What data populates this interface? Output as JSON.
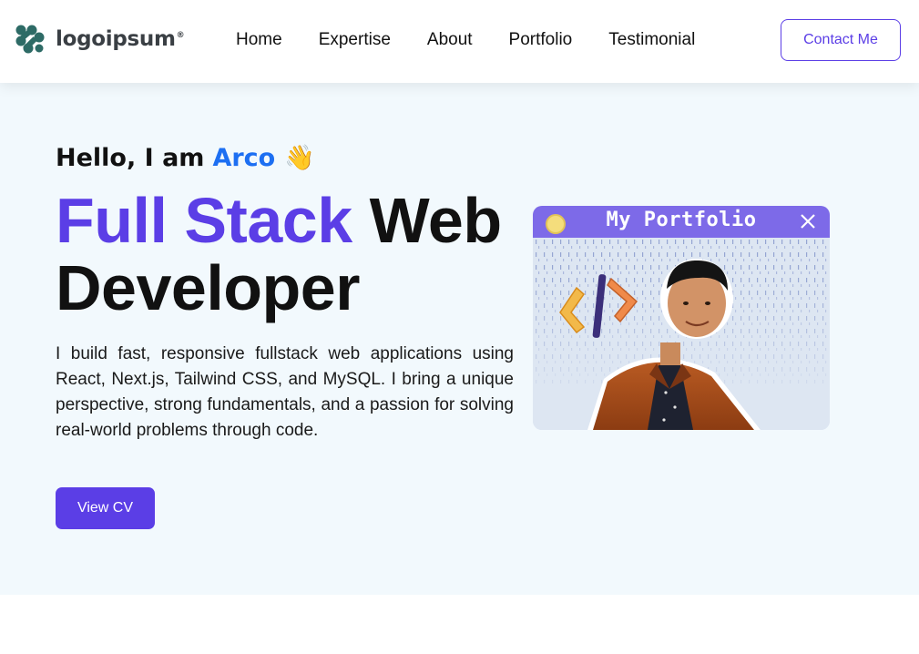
{
  "nav": {
    "logo_text": "logoipsum",
    "logo_mark": "®",
    "links": [
      "Home",
      "Expertise",
      "About",
      "Portfolio",
      "Testimonial"
    ],
    "contact_label": "Contact Me"
  },
  "hero": {
    "greeting": "Hello, I am",
    "name": "Arco",
    "wave": "👋",
    "headline_accent": "Full Stack",
    "headline_rest": " Web Developer",
    "description": "I build fast, responsive fullstack web applications using React, Next.js, Tailwind CSS, and MySQL. I bring a unique perspective, strong fundamentals, and a passion for solving real-world problems through code.",
    "cv_label": "View CV"
  },
  "portfolio_card": {
    "title": "My Portfolio",
    "code_symbol": "</>"
  },
  "colors": {
    "brand_purple": "#5b3ee6",
    "name_blue": "#1d6ff2",
    "hero_bg": "#f2f9fd",
    "window_bar": "#7d6ae8"
  },
  "icons": [
    "logo-icon",
    "wave-hand-icon",
    "close-icon",
    "window-dot-icon",
    "code-tag-icon"
  ]
}
